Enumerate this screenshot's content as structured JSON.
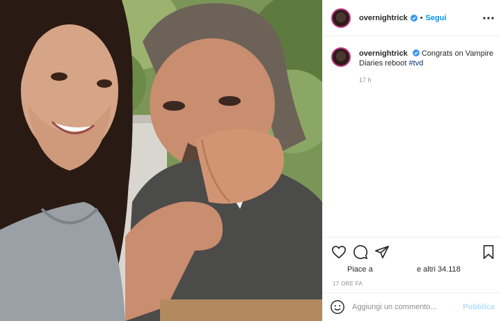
{
  "post": {
    "username": "overnightrick",
    "follow_label": "Segui",
    "separator": "•",
    "caption_text": "Congrats on Vampire Diaries reboot",
    "hashtag": "#tvd",
    "caption_time": "17 h",
    "likes_prefix": "Piace a",
    "likes_suffix": "e altri 34.118",
    "post_time": "17 ORE FA",
    "comment_placeholder": "Aggiungi un commento...",
    "publish_label": "Pubblica"
  },
  "icons": {
    "verified": "verified-badge-icon",
    "more": "more-options-icon",
    "like": "heart-icon",
    "comment": "comment-bubble-icon",
    "share": "paper-plane-icon",
    "save": "bookmark-icon",
    "emoji": "smiley-icon"
  },
  "colors": {
    "accent": "#0095f6",
    "verified": "#3897f0",
    "publish_disabled": "#b2dffc",
    "muted": "#8e8e8e",
    "border": "#efefef"
  }
}
